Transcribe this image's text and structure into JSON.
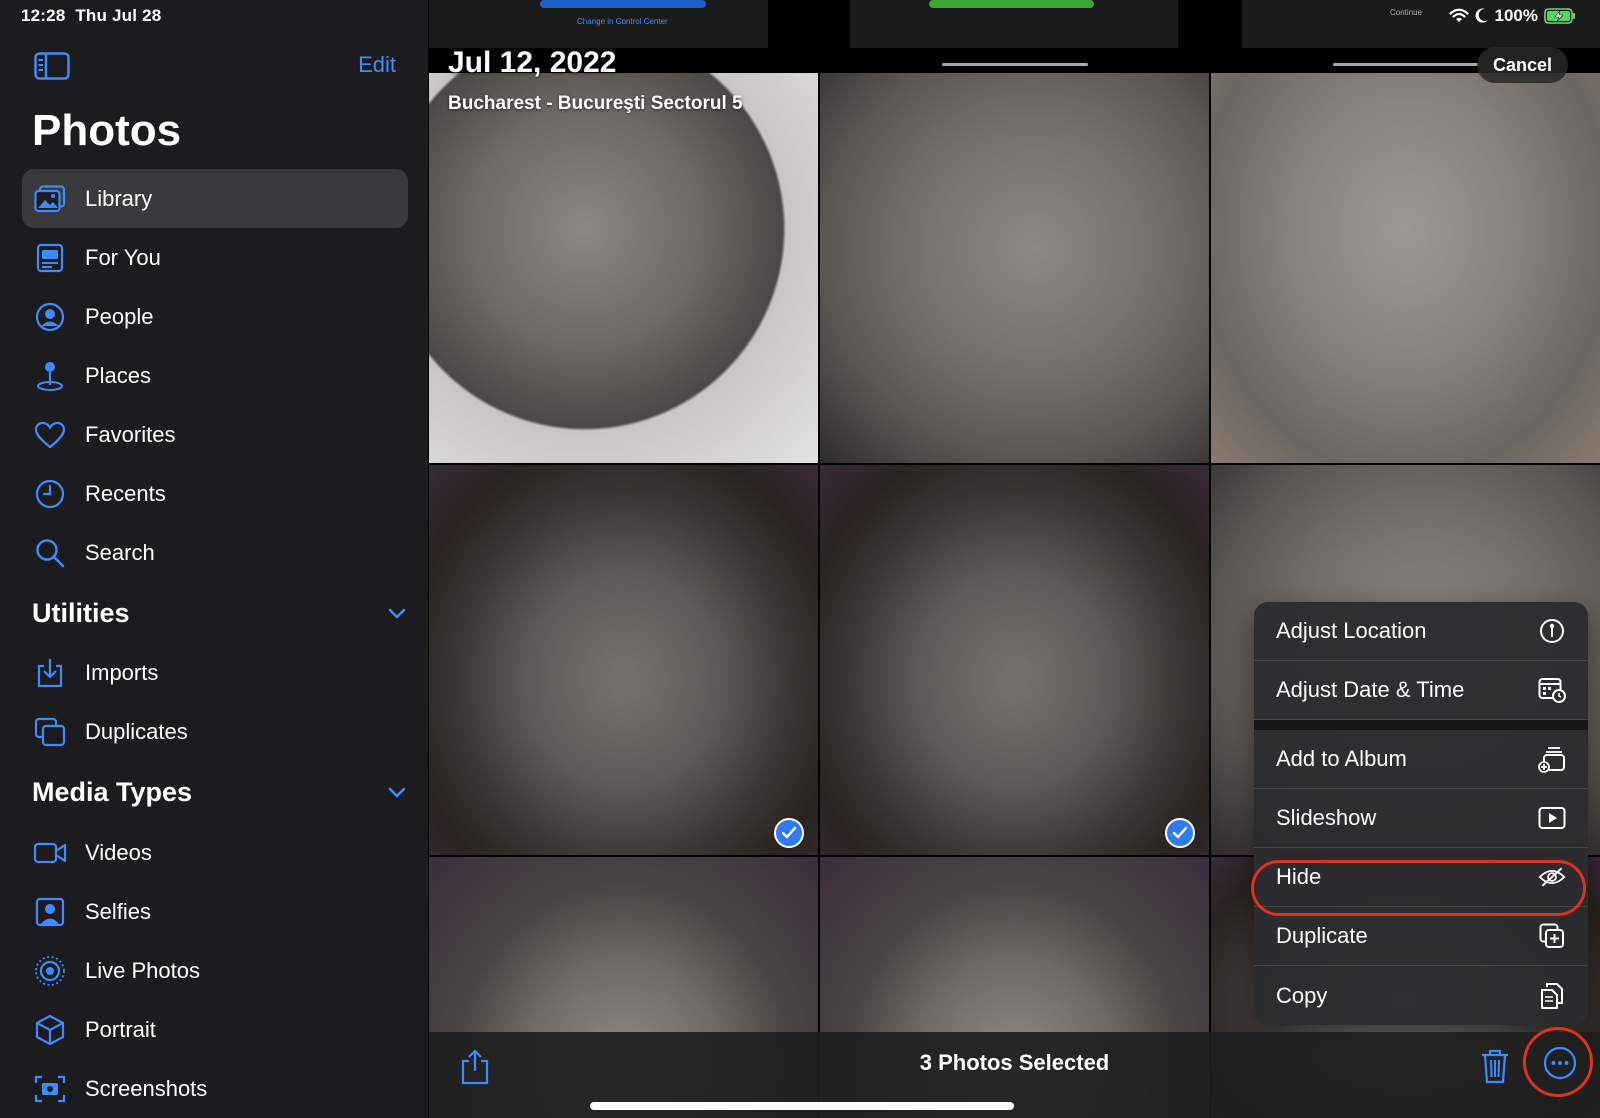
{
  "status_bar": {
    "time": "12:28",
    "date": "Thu Jul 28",
    "battery": "100%"
  },
  "sidebar": {
    "edit_label": "Edit",
    "title": "Photos",
    "items": [
      {
        "label": "Library",
        "icon": "library-icon",
        "active": true
      },
      {
        "label": "For You",
        "icon": "for-you-icon"
      },
      {
        "label": "People",
        "icon": "people-icon"
      },
      {
        "label": "Places",
        "icon": "places-icon"
      },
      {
        "label": "Favorites",
        "icon": "heart-icon"
      },
      {
        "label": "Recents",
        "icon": "clock-icon"
      },
      {
        "label": "Search",
        "icon": "search-icon"
      }
    ],
    "utilities": {
      "title": "Utilities",
      "items": [
        {
          "label": "Imports",
          "icon": "imports-icon"
        },
        {
          "label": "Duplicates",
          "icon": "duplicates-icon"
        }
      ]
    },
    "media_types": {
      "title": "Media Types",
      "items": [
        {
          "label": "Videos",
          "icon": "video-icon"
        },
        {
          "label": "Selfies",
          "icon": "selfie-icon"
        },
        {
          "label": "Live Photos",
          "icon": "live-photo-icon"
        },
        {
          "label": "Portrait",
          "icon": "portrait-icon"
        },
        {
          "label": "Screenshots",
          "icon": "screenshot-icon"
        }
      ]
    }
  },
  "main": {
    "date_title": "Jul 12, 2022",
    "location": "Bucharest - Bucureşti Sectorul 5",
    "cancel_label": "Cancel",
    "top_strip_text_1": "Change in Control Center",
    "top_strip_text_2": "Continue"
  },
  "context_menu": {
    "items": [
      {
        "label": "Adjust Location",
        "icon": "location-info-icon"
      },
      {
        "label": "Adjust Date & Time",
        "icon": "calendar-clock-icon"
      },
      {
        "label": "Add to Album",
        "icon": "add-to-album-icon"
      },
      {
        "label": "Slideshow",
        "icon": "play-icon"
      },
      {
        "label": "Hide",
        "icon": "eye-slash-icon"
      },
      {
        "label": "Duplicate",
        "icon": "duplicate-icon"
      },
      {
        "label": "Copy",
        "icon": "copy-icon"
      }
    ]
  },
  "toolbar": {
    "selected_label": "3 Photos Selected"
  },
  "colors": {
    "accent": "#3d8bff",
    "highlight_ring": "#e0301e",
    "sidebar_bg": "#1c1c1e"
  }
}
